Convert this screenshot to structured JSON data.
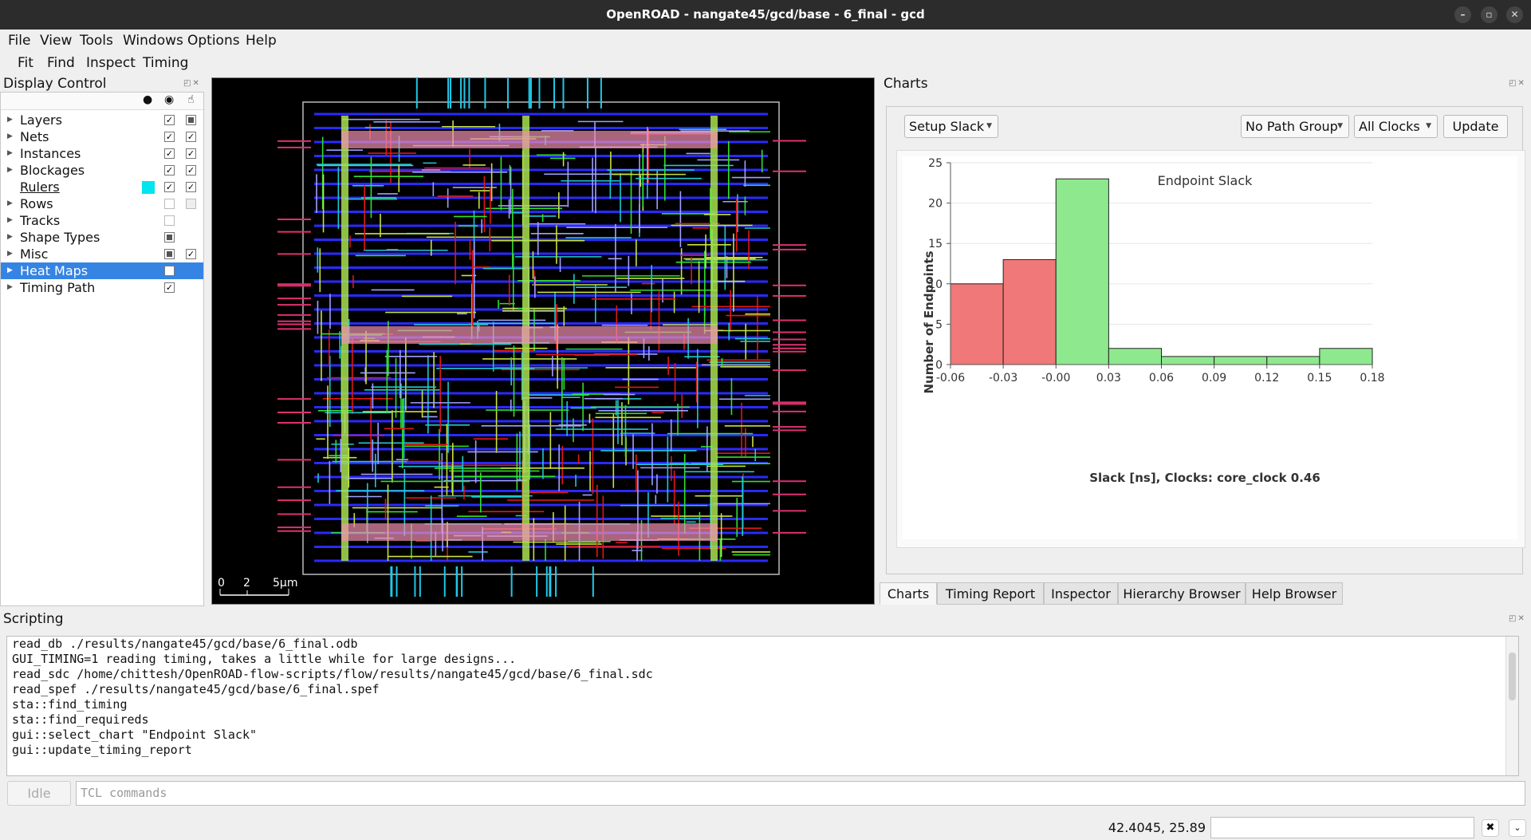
{
  "window": {
    "title": "OpenROAD - nangate45/gcd/base - 6_final - gcd"
  },
  "menu": [
    "File",
    "View",
    "Tools",
    "Windows",
    "Options",
    "Help"
  ],
  "toolbar": [
    "Fit",
    "Find",
    "Inspect",
    "Timing"
  ],
  "display_control": {
    "title": "Display Control",
    "items": [
      {
        "label": "Layers",
        "visible": "✓",
        "select": "partial"
      },
      {
        "label": "Nets",
        "visible": "✓",
        "select": "✓"
      },
      {
        "label": "Instances",
        "visible": "✓",
        "select": "✓"
      },
      {
        "label": "Blockages",
        "visible": "✓",
        "select": "✓"
      },
      {
        "label": "Rulers",
        "color": "#00e5ee",
        "visible": "✓",
        "select": "✓"
      },
      {
        "label": "Rows",
        "visible": "",
        "select": ""
      },
      {
        "label": "Tracks",
        "visible": ""
      },
      {
        "label": "Shape Types",
        "visible": "partial"
      },
      {
        "label": "Misc",
        "visible": "partial",
        "select": "✓"
      },
      {
        "label": "Heat Maps",
        "visible": ""
      },
      {
        "label": "Timing Path",
        "visible": "✓"
      }
    ]
  },
  "layout": {
    "scale_labels": [
      "0",
      "2",
      "5μm"
    ]
  },
  "charts": {
    "title": "Charts",
    "chart_select": "Setup Slack",
    "path_group": "No Path Group",
    "clocks": "All Clocks",
    "update_label": "Update"
  },
  "chart_data": {
    "type": "bar",
    "title": "Endpoint Slack",
    "xlabel": "Slack [ns], Clocks: core_clock 0.46",
    "ylabel": "Number of Endpoints",
    "x_ticks": [
      "-0.06",
      "-0.03",
      "-0.00",
      "0.03",
      "0.06",
      "0.09",
      "0.12",
      "0.15",
      "0.18"
    ],
    "y_ticks": [
      "0",
      "5",
      "10",
      "15",
      "20",
      "25"
    ],
    "ylim": [
      0,
      25
    ],
    "bins": [
      {
        "from": -0.06,
        "to": -0.03,
        "count": 10,
        "color": "#f07878"
      },
      {
        "from": -0.03,
        "to": -0.0,
        "count": 13,
        "color": "#f07878"
      },
      {
        "from": -0.0,
        "to": 0.03,
        "count": 23,
        "color": "#8ee88e"
      },
      {
        "from": 0.03,
        "to": 0.06,
        "count": 2,
        "color": "#8ee88e"
      },
      {
        "from": 0.06,
        "to": 0.09,
        "count": 1,
        "color": "#8ee88e"
      },
      {
        "from": 0.09,
        "to": 0.12,
        "count": 1,
        "color": "#8ee88e"
      },
      {
        "from": 0.12,
        "to": 0.15,
        "count": 1,
        "color": "#8ee88e"
      },
      {
        "from": 0.15,
        "to": 0.18,
        "count": 2,
        "color": "#8ee88e"
      }
    ]
  },
  "tabs": [
    "Charts",
    "Timing Report",
    "Inspector",
    "Hierarchy Browser",
    "Help Browser"
  ],
  "scripting": {
    "title": "Scripting",
    "log": [
      "read_db ./results/nangate45/gcd/base/6_final.odb",
      "GUI_TIMING=1 reading timing, takes a little while for large designs...",
      "read_sdc /home/chittesh/OpenROAD-flow-scripts/flow/results/nangate45/gcd/base/6_final.sdc",
      "read_spef ./results/nangate45/gcd/base/6_final.spef",
      "sta::find_timing",
      "sta::find_requireds",
      "gui::select_chart \"Endpoint Slack\"",
      "gui::update_timing_report"
    ],
    "status": "Idle",
    "input_placeholder": "TCL commands"
  },
  "statusbar": {
    "coords": "42.4045, 25.89"
  }
}
